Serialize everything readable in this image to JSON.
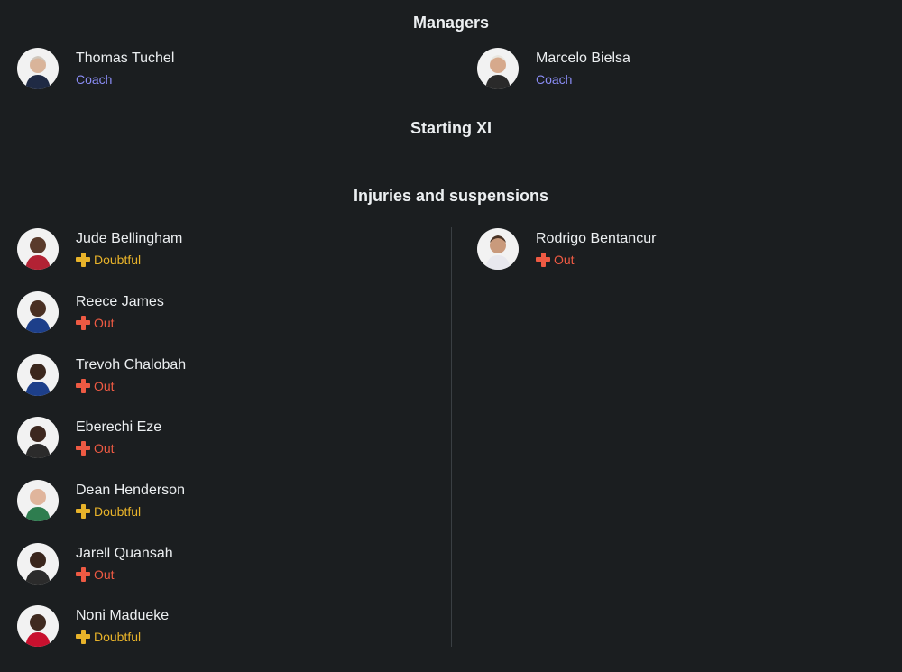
{
  "managers": {
    "title": "Managers",
    "home": {
      "name": "Thomas Tuchel",
      "role": "Coach"
    },
    "away": {
      "name": "Marcelo Bielsa",
      "role": "Coach"
    }
  },
  "starting_xi": {
    "title": "Starting XI"
  },
  "injuries": {
    "title": "Injuries and suspensions",
    "home": [
      {
        "name": "Jude Bellingham",
        "status": "Doubtful"
      },
      {
        "name": "Reece James",
        "status": "Out"
      },
      {
        "name": "Trevoh Chalobah",
        "status": "Out"
      },
      {
        "name": "Eberechi Eze",
        "status": "Out"
      },
      {
        "name": "Dean Henderson",
        "status": "Doubtful"
      },
      {
        "name": "Jarell Quansah",
        "status": "Out"
      },
      {
        "name": "Noni Madueke",
        "status": "Doubtful"
      }
    ],
    "away": [
      {
        "name": "Rodrigo Bentancur",
        "status": "Out"
      }
    ]
  },
  "colors": {
    "background": "#1b1e20",
    "coach": "#8a8cf5",
    "out": "#ee5a43",
    "doubtful": "#e8b32a"
  },
  "icons": {
    "avatar": "player-avatar-icon",
    "status": "plus-cross-icon"
  }
}
